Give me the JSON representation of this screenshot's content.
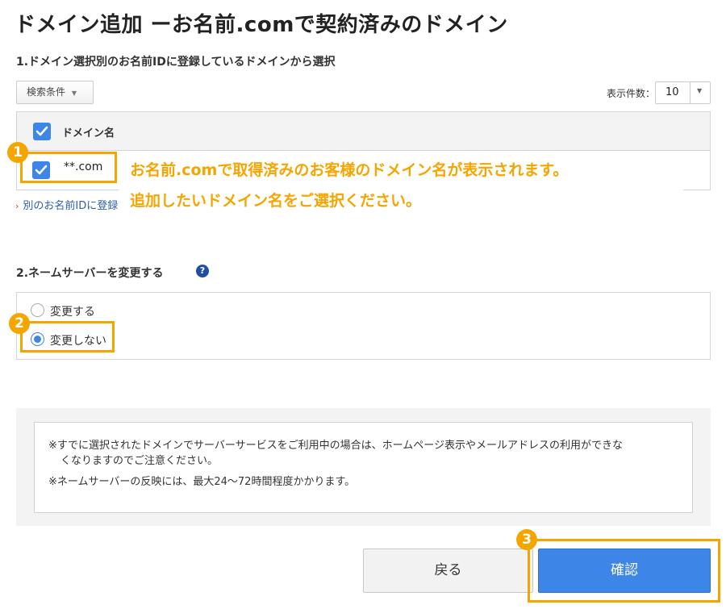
{
  "page": {
    "title": "ドメイン追加 ーお名前.comで契約済みのドメイン"
  },
  "section1": {
    "title": "1.ドメイン選択別のお名前IDに登録しているドメインから選択",
    "search_conditions": "検索条件",
    "page_size_label": "表示件数：",
    "page_size_value": "10",
    "table": {
      "header": "ドメイン名",
      "rows": [
        {
          "domain": "**.com",
          "checked": true
        }
      ]
    },
    "other_id_link": "別のお名前IDに登録しているドメインから選択"
  },
  "annotations": {
    "badge1": "1",
    "badge2": "2",
    "badge3": "3",
    "line1": "お名前.comで取得済みのお客様のドメイン名が表示されます。",
    "line2": "追加したいドメイン名をご選択ください。",
    "color": "#f5a500"
  },
  "section2": {
    "title": "2.ネームサーバーを変更する",
    "help_icon": "?",
    "options": [
      {
        "label": "変更する",
        "selected": false
      },
      {
        "label": "変更しない",
        "selected": true
      }
    ]
  },
  "notice": {
    "line1a": "※すでに選択されたドメインでサーバーサービスをご利用中の場合は、ホームページ表示やメールアドレスの利用ができな",
    "line1b": "くなりますのでご注意ください。",
    "line2": "※ネームサーバーの反映には、最大24～72時間程度かかります。"
  },
  "buttons": {
    "back": "戻る",
    "confirm": "確認"
  },
  "colors": {
    "accent": "#3d86e8",
    "highlight": "#f5a500",
    "link": "#2e5fa8"
  }
}
